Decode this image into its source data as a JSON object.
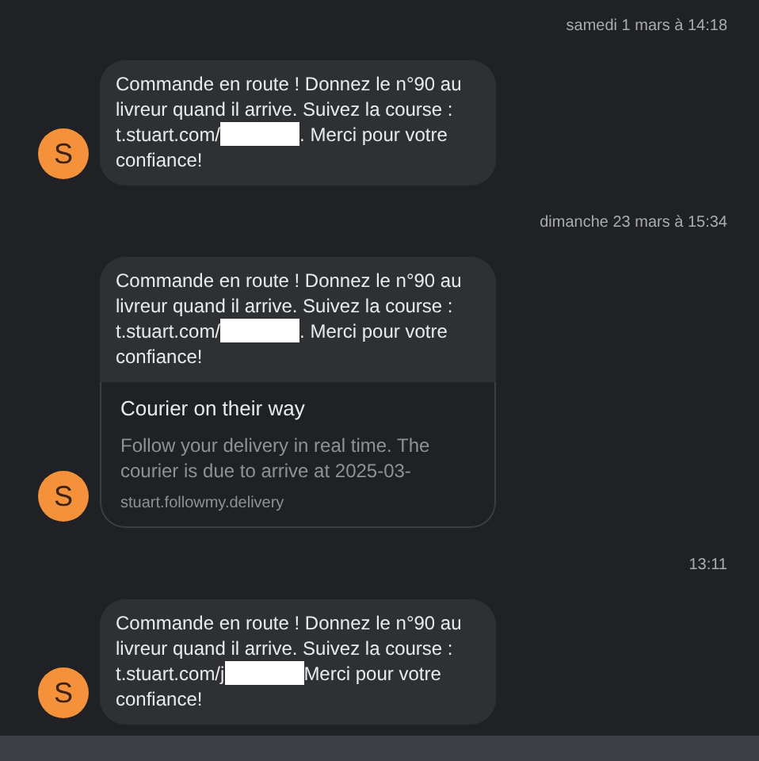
{
  "messages": [
    {
      "timestamp": "samedi 1 mars à 14:18",
      "sender_initial": "S",
      "text_before": "Commande en route ! Donnez le n°90 au livreur quand il arrive. Suivez la course : t.stuart.com/",
      "text_after": ". Merci pour votre confiance!"
    },
    {
      "timestamp": "dimanche 23 mars à 15:34",
      "sender_initial": "S",
      "text_before": "Commande en route ! Donnez le n°90 au livreur quand il arrive. Suivez la course : t.stuart.com/",
      "text_after": ". Merci pour votre confiance!",
      "preview": {
        "title": "Courier on their way",
        "description": "Follow your delivery in real time. The courier is due to arrive at 2025-03-",
        "domain": "stuart.followmy.delivery"
      }
    },
    {
      "timestamp": "13:11",
      "sender_initial": "S",
      "text_before": "Commande en route ! Donnez le n°90 au livreur quand il arrive. Suivez la course : t.stuart.com/j",
      "text_after": "Merci pour votre confiance!"
    }
  ]
}
